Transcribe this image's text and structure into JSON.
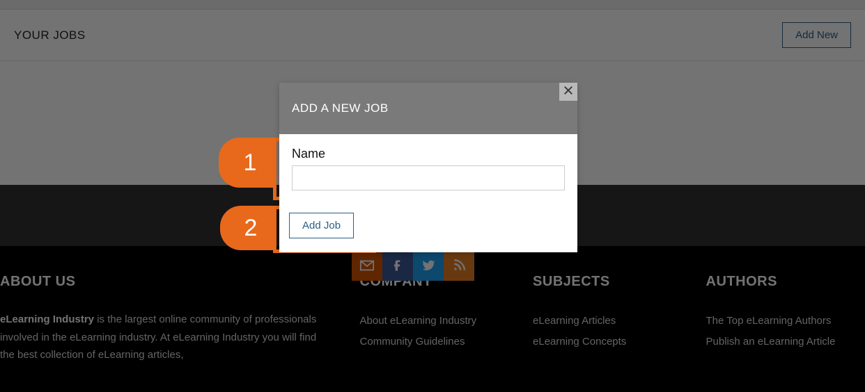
{
  "header": {
    "title": "YOUR JOBS",
    "add_new_label": "Add New"
  },
  "modal": {
    "title": "ADD A NEW JOB",
    "name_label": "Name",
    "name_value": "",
    "add_job_label": "Add Job"
  },
  "callouts": {
    "one": "1",
    "two": "2"
  },
  "footer": {
    "about": {
      "heading": "ABOUT US",
      "text_strong": "eLearning Industry",
      "text_rest": " is the largest online community of professionals involved in the eLearning industry. At eLearning Industry you will find the best collection of eLearning articles,"
    },
    "company": {
      "heading": "COMPANY",
      "links": [
        "About eLearning Industry",
        "Community Guidelines"
      ]
    },
    "subjects": {
      "heading": "SUBJECTS",
      "links": [
        "eLearning Articles",
        "eLearning Concepts"
      ]
    },
    "authors": {
      "heading": "AUTHORS",
      "links": [
        "The Top eLearning Authors",
        "Publish an eLearning Article"
      ]
    }
  }
}
